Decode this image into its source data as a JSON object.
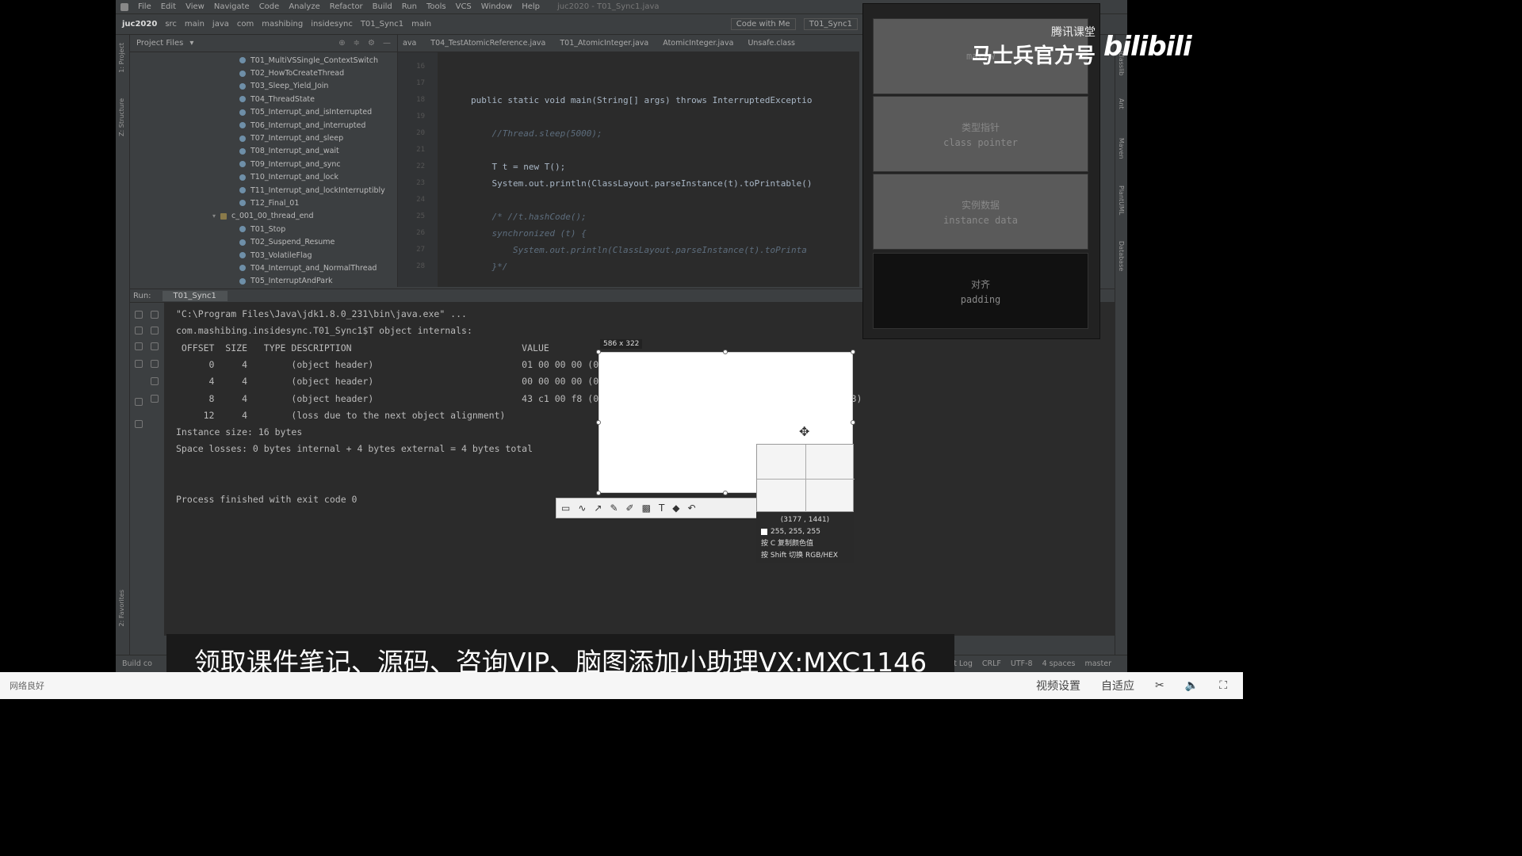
{
  "menu": {
    "items": [
      "File",
      "Edit",
      "View",
      "Navigate",
      "Code",
      "Analyze",
      "Refactor",
      "Build",
      "Run",
      "Tools",
      "VCS",
      "Window",
      "Help"
    ],
    "window_title": "juc2020 - T01_Sync1.java"
  },
  "breadcrumbs": {
    "items": [
      "juc2020",
      "src",
      "main",
      "java",
      "com",
      "mashibing",
      "insidesync",
      "T01_Sync1",
      "main"
    ],
    "code_with_me": "Code with Me",
    "run_config": "T01_Sync1"
  },
  "project": {
    "header": "Project Files",
    "tree": [
      {
        "label": "T01_MultiVSSingle_ContextSwitch",
        "type": "file"
      },
      {
        "label": "T02_HowToCreateThread",
        "type": "file"
      },
      {
        "label": "T03_Sleep_Yield_Join",
        "type": "file"
      },
      {
        "label": "T04_ThreadState",
        "type": "file"
      },
      {
        "label": "T05_Interrupt_and_isInterrupted",
        "type": "file"
      },
      {
        "label": "T06_Interrupt_and_interrupted",
        "type": "file"
      },
      {
        "label": "T07_Interrupt_and_sleep",
        "type": "file"
      },
      {
        "label": "T08_Interrupt_and_wait",
        "type": "file"
      },
      {
        "label": "T09_Interrupt_and_sync",
        "type": "file"
      },
      {
        "label": "T10_Interrupt_and_lock",
        "type": "file"
      },
      {
        "label": "T11_Interrupt_and_lockInterruptibly",
        "type": "file"
      },
      {
        "label": "T12_Final_01",
        "type": "file"
      },
      {
        "label": "c_001_00_thread_end",
        "type": "folder"
      },
      {
        "label": "T01_Stop",
        "type": "file"
      },
      {
        "label": "T02_Suspend_Resume",
        "type": "file"
      },
      {
        "label": "T03_VolatileFlag",
        "type": "file"
      },
      {
        "label": "T04_Interrupt_and_NormalThread",
        "type": "file"
      },
      {
        "label": "T05_InterruptAndPark",
        "type": "file"
      }
    ]
  },
  "editor": {
    "tabs": [
      "ava",
      "T04_TestAtomicReference.java",
      "T01_AtomicInteger.java",
      "AtomicInteger.java",
      "Unsafe.class"
    ],
    "lines": [
      {
        "num": "16",
        "text": ""
      },
      {
        "num": "17",
        "text": ""
      },
      {
        "num": "18",
        "text": "public static void main(String[] args) throws InterruptedExceptio"
      },
      {
        "num": "19",
        "text": ""
      },
      {
        "num": "20",
        "text": "    //Thread.sleep(5000);"
      },
      {
        "num": "21",
        "text": ""
      },
      {
        "num": "22",
        "text": "    T t = new T();"
      },
      {
        "num": "23",
        "text": "    System.out.println(ClassLayout.parseInstance(t).toPrintable()"
      },
      {
        "num": "24",
        "text": ""
      },
      {
        "num": "25",
        "text": "    /* //t.hashCode();"
      },
      {
        "num": "26",
        "text": "    synchronized (t) {"
      },
      {
        "num": "27",
        "text": "        System.out.println(ClassLayout.parseInstance(t).toPrinta"
      },
      {
        "num": "28",
        "text": "    }*/"
      }
    ]
  },
  "layout_panel": {
    "boxes": [
      {
        "cn": "",
        "en": "markw"
      },
      {
        "cn": "类型指针",
        "en": "class pointer"
      },
      {
        "cn": "实例数据",
        "en": "instance data"
      },
      {
        "cn": "对齐",
        "en": "padding"
      }
    ]
  },
  "watermark": {
    "tencent": "腾讯课堂",
    "mashibing": "马士兵官方号",
    "bilibili": "bilibili"
  },
  "run": {
    "label": "Run:",
    "tab": "T01_Sync1",
    "console": [
      "\"C:\\Program Files\\Java\\jdk1.8.0_231\\bin\\java.exe\" ...",
      "com.mashibing.insidesync.T01_Sync1$T object internals:",
      " OFFSET  SIZE   TYPE DESCRIPTION                               VALUE",
      "      0     4        (object header)                           01 00 00 00 (00000001 00000000 00000000 00000000) (1)",
      "      4     4        (object header)                           00 00 00 00 (00000000 00000000 00000000 00000000) (0)",
      "      8     4        (object header)                           43 c1 00 f8 (01000011 11000001 00000000 11111000) (-134168253)",
      "     12     4        (loss due to the next object alignment)",
      "Instance size: 16 bytes",
      "Space losses: 0 bytes internal + 4 bytes external = 4 bytes total",
      "",
      "",
      "Process finished with exit code 0"
    ]
  },
  "snip": {
    "size": "586 x 322",
    "coords": "(3177 , 1441)",
    "rgb": "255, 255, 255",
    "hint1": "按 C 复制颜色值",
    "hint2": "按 Shift 切换 RGB/HEX"
  },
  "statusbar": {
    "left": "Build co",
    "event_log": "Event Log",
    "right": [
      "CRLF",
      "UTF-8",
      "4 spaces",
      "master"
    ]
  },
  "caption": "领取课件笔记、源码、咨询VIP、脑图添加小助理VX:MXC1146",
  "player": {
    "left": "网络良好",
    "right": [
      "视频设置",
      "自适应"
    ]
  }
}
